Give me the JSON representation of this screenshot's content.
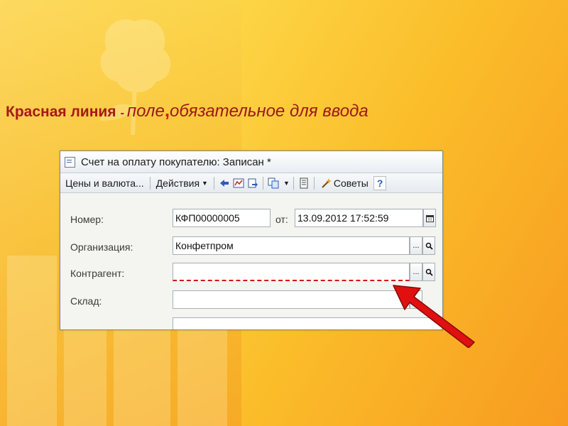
{
  "headline": {
    "red_part": "Красная линия",
    "dash": "-",
    "field_part": "поле",
    "comma": ",",
    "rest": "обязательное для ввода"
  },
  "window": {
    "title": "Счет на оплату покупателю: Записан *",
    "toolbar": {
      "prices_label": "Цены и валюта...",
      "actions_label": "Действия",
      "advice_label": "Советы",
      "help_label": "?"
    },
    "fields": {
      "number_label": "Номер:",
      "number_value": "КФП00000005",
      "from_label": "от:",
      "date_value": "13.09.2012 17:52:59",
      "organization_label": "Организация:",
      "organization_value": "Конфетпром",
      "counterparty_label": "Контрагент:",
      "counterparty_value": "",
      "warehouse_label": "Склад:",
      "warehouse_value": ""
    },
    "ellipsis": "...",
    "search_icon": "magnifier-icon",
    "calendar_icon": "calendar-icon"
  },
  "colors": {
    "headline_red": "#a81818",
    "pointer_arrow": "#e01010",
    "required_underline": "#d01818"
  }
}
